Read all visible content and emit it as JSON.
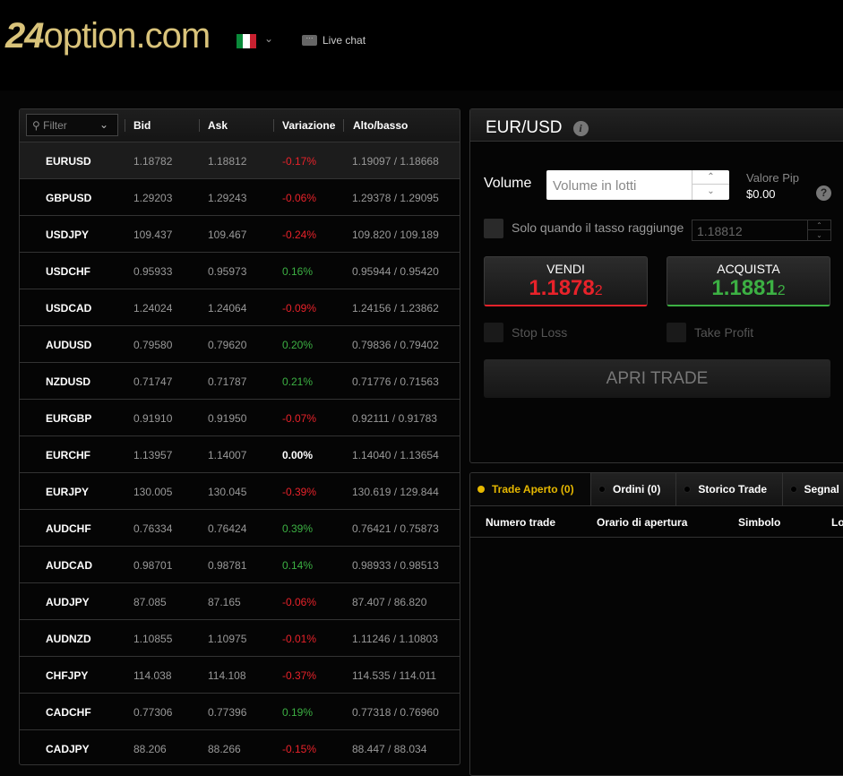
{
  "header": {
    "logo": "24option.com",
    "language": "Italiano",
    "live_chat": "Live chat"
  },
  "list": {
    "filter_placeholder": "Filter",
    "columns": [
      "Bid",
      "Ask",
      "Variazione",
      "Alto/basso"
    ],
    "rows": [
      {
        "symbol": "EURUSD",
        "bid": "1.18782",
        "ask": "1.18812",
        "change": "-0.17%",
        "hilo": "1.19097 / 1.18668",
        "dir": "neg",
        "selected": true
      },
      {
        "symbol": "GBPUSD",
        "bid": "1.29203",
        "ask": "1.29243",
        "change": "-0.06%",
        "hilo": "1.29378 / 1.29095",
        "dir": "neg"
      },
      {
        "symbol": "USDJPY",
        "bid": "109.437",
        "ask": "109.467",
        "change": "-0.24%",
        "hilo": "109.820 / 109.189",
        "dir": "neg"
      },
      {
        "symbol": "USDCHF",
        "bid": "0.95933",
        "ask": "0.95973",
        "change": "0.16%",
        "hilo": "0.95944 / 0.95420",
        "dir": "pos"
      },
      {
        "symbol": "USDCAD",
        "bid": "1.24024",
        "ask": "1.24064",
        "change": "-0.09%",
        "hilo": "1.24156 / 1.23862",
        "dir": "neg"
      },
      {
        "symbol": "AUDUSD",
        "bid": "0.79580",
        "ask": "0.79620",
        "change": "0.20%",
        "hilo": "0.79836 / 0.79402",
        "dir": "pos"
      },
      {
        "symbol": "NZDUSD",
        "bid": "0.71747",
        "ask": "0.71787",
        "change": "0.21%",
        "hilo": "0.71776 / 0.71563",
        "dir": "pos"
      },
      {
        "symbol": "EURGBP",
        "bid": "0.91910",
        "ask": "0.91950",
        "change": "-0.07%",
        "hilo": "0.92111 / 0.91783",
        "dir": "neg"
      },
      {
        "symbol": "EURCHF",
        "bid": "1.13957",
        "ask": "1.14007",
        "change": "0.00%",
        "hilo": "1.14040 / 1.13654",
        "dir": "zero"
      },
      {
        "symbol": "EURJPY",
        "bid": "130.005",
        "ask": "130.045",
        "change": "-0.39%",
        "hilo": "130.619 / 129.844",
        "dir": "neg"
      },
      {
        "symbol": "AUDCHF",
        "bid": "0.76334",
        "ask": "0.76424",
        "change": "0.39%",
        "hilo": "0.76421 / 0.75873",
        "dir": "pos"
      },
      {
        "symbol": "AUDCAD",
        "bid": "0.98701",
        "ask": "0.98781",
        "change": "0.14%",
        "hilo": "0.98933 / 0.98513",
        "dir": "pos"
      },
      {
        "symbol": "AUDJPY",
        "bid": "87.085",
        "ask": "87.165",
        "change": "-0.06%",
        "hilo": "87.407 / 86.820",
        "dir": "neg"
      },
      {
        "symbol": "AUDNZD",
        "bid": "1.10855",
        "ask": "1.10975",
        "change": "-0.01%",
        "hilo": "1.11246 / 1.10803",
        "dir": "neg"
      },
      {
        "symbol": "CHFJPY",
        "bid": "114.038",
        "ask": "114.108",
        "change": "-0.37%",
        "hilo": "114.535 / 114.011",
        "dir": "neg"
      },
      {
        "symbol": "CADCHF",
        "bid": "0.77306",
        "ask": "0.77396",
        "change": "0.19%",
        "hilo": "0.77318 / 0.76960",
        "dir": "pos"
      },
      {
        "symbol": "CADJPY",
        "bid": "88.206",
        "ask": "88.266",
        "change": "-0.15%",
        "hilo": "88.447 / 88.034",
        "dir": "neg"
      }
    ]
  },
  "trade": {
    "pair": "EUR/USD",
    "volume_label": "Volume",
    "volume_placeholder": "Volume in lotti",
    "pip_label": "Valore Pip",
    "pip_value": "$0.00",
    "rate_label": "Solo quando il tasso raggiunge",
    "rate_value": "1.18812",
    "sell": {
      "label": "VENDI",
      "price": "1.1878",
      "pip": "2"
    },
    "buy": {
      "label": "ACQUISTA",
      "price": "1.1881",
      "pip": "2"
    },
    "stop_loss": "Stop Loss",
    "take_profit": "Take Profit",
    "open_trade": "APRI TRADE"
  },
  "colors": {
    "sell": "#e8222a",
    "buy": "#3cb043",
    "accent": "#e6b800",
    "logo": "#d9c37a"
  },
  "positions": {
    "tabs": [
      "Trade Aperto (0)",
      "Ordini (0)",
      "Storico Trade",
      "Segnal"
    ],
    "active_tab": 0,
    "columns": [
      "Numero trade",
      "Orario di apertura",
      "Simbolo",
      "Lo"
    ]
  }
}
